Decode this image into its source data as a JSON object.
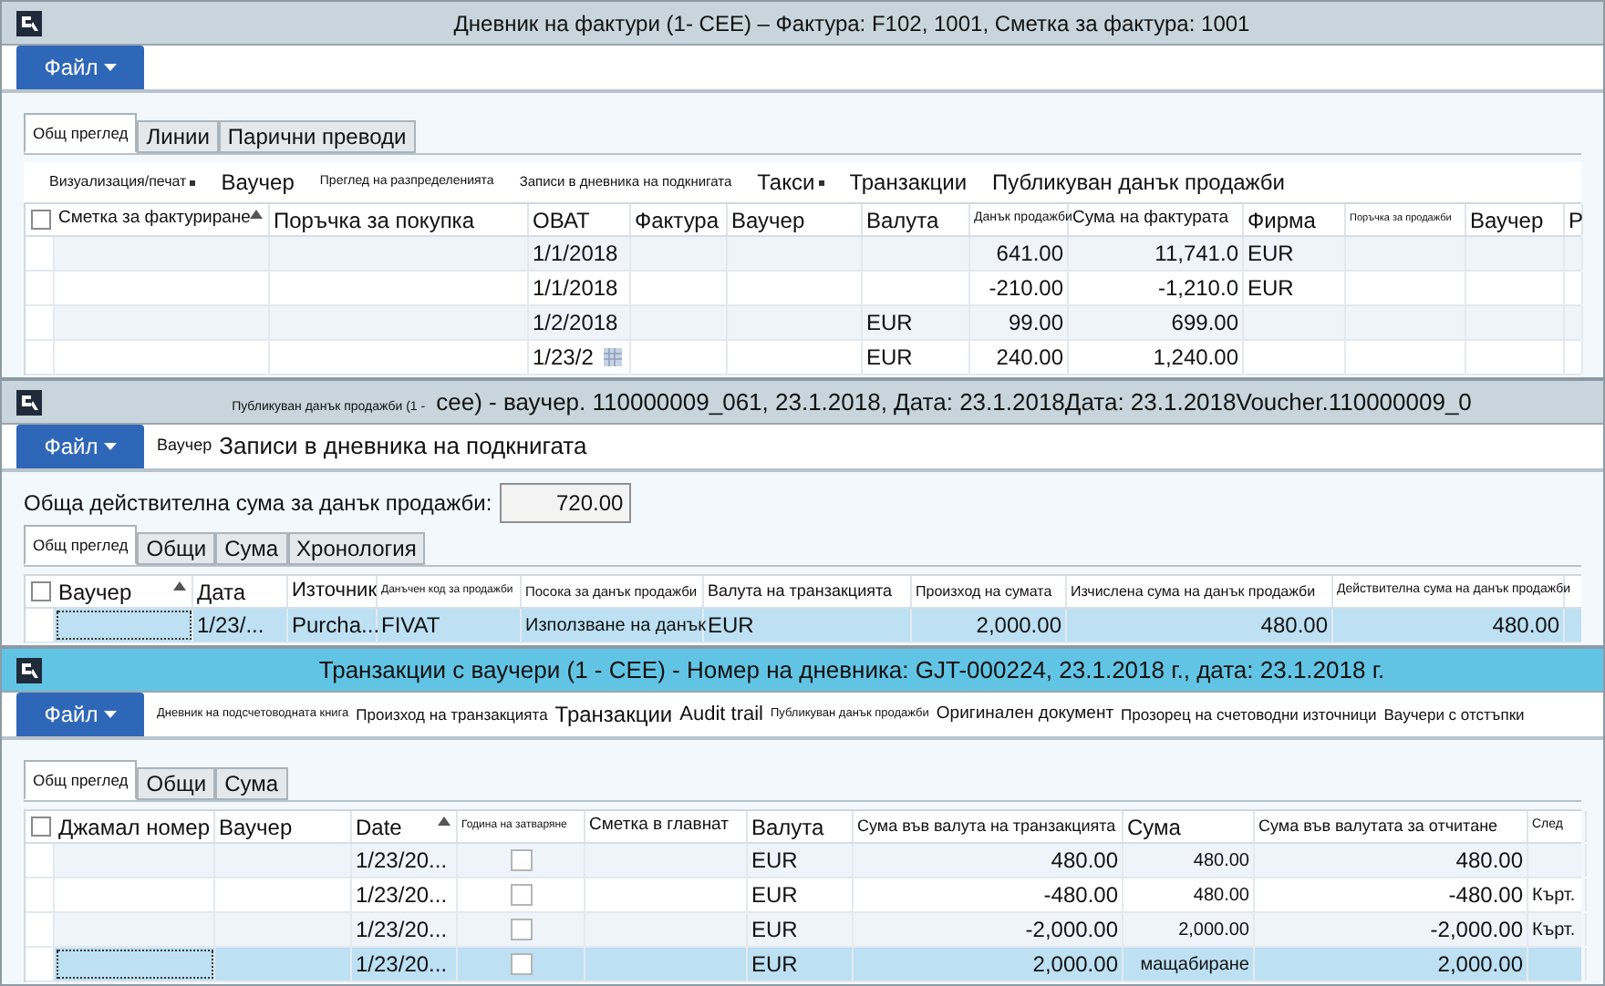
{
  "windows": [
    {
      "active": false,
      "title_parts": [
        "Дневник на фактури (1- CEE) –  Фактура: F102, 1001, Сметка за фактура: 1001"
      ],
      "file_button": "Файл",
      "tabs": [
        {
          "label": "Общ преглед",
          "selected": true
        },
        {
          "label": "Линии",
          "selected": false
        },
        {
          "label": "Парични преводи",
          "selected": false
        }
      ],
      "toolbar": [
        {
          "label": "Визуализация/печат",
          "dropdown": true
        },
        {
          "label": "Ваучер",
          "dropdown": false
        },
        {
          "label": "Преглед на разпределенията",
          "dropdown": false
        },
        {
          "label": "Записи в дневника на подкнигата",
          "dropdown": false
        },
        {
          "label": "Такси",
          "dropdown": true
        },
        {
          "label": "Транзакции",
          "dropdown": false
        },
        {
          "label": "Публикуван данък продажби",
          "dropdown": false
        }
      ],
      "grid": {
        "all_selected": false,
        "columns": [
          {
            "label": "Сметка за фактуриране",
            "kind": "text",
            "sorted": true
          },
          {
            "label": "Поръчка за покупка",
            "kind": "text",
            "sorted": false
          },
          {
            "label": "ОВАТ",
            "kind": "text",
            "sorted": false
          },
          {
            "label": "Фактура",
            "kind": "text",
            "sorted": false
          },
          {
            "label": "Ваучер",
            "kind": "text",
            "sorted": false
          },
          {
            "label": "Валута",
            "kind": "text",
            "sorted": false
          },
          {
            "label": "Данък продажби",
            "kind": "number",
            "sorted": false
          },
          {
            "label": "Сума на фактурата",
            "kind": "number",
            "sorted": false
          },
          {
            "label": "Фирма",
            "kind": "text",
            "sorted": false
          },
          {
            "label": "Поръчка за продажби",
            "kind": "text",
            "sorted": false
          },
          {
            "label": "Ваучер",
            "kind": "text",
            "sorted": false
          },
          {
            "label": "Р",
            "kind": "text",
            "sorted": false
          }
        ],
        "rows": [
          {
            "selected": false,
            "date_picker": false,
            "cells": [
              null,
              null,
              "1/1/2018",
              null,
              null,
              null,
              "641.00",
              "11,741.0",
              "EUR",
              null,
              null,
              null
            ]
          },
          {
            "selected": false,
            "date_picker": false,
            "cells": [
              null,
              null,
              "1/1/2018",
              null,
              null,
              null,
              "-210.00",
              "-1,210.0",
              "EUR",
              null,
              null,
              null
            ]
          },
          {
            "selected": false,
            "date_picker": false,
            "cells": [
              null,
              null,
              "1/2/2018",
              null,
              null,
              "EUR",
              "99.00",
              "699.00",
              null,
              null,
              null,
              null
            ]
          },
          {
            "selected": false,
            "date_picker": true,
            "cells": [
              null,
              null,
              "1/23/2",
              null,
              null,
              "EUR",
              "240.00",
              "1,240.00",
              null,
              null,
              null,
              null
            ]
          }
        ]
      }
    },
    {
      "active": false,
      "title_parts": [
        "Публикуван данък продажби (1 -",
        "cee) - ваучер. 110000009_061, 23.1.2018, Дата: 23.1.2018Дата: 23.1.2018Voucher.110000009_0"
      ],
      "file_button": "Файл",
      "menu": [
        "Ваучер",
        "Записи в дневника на подкнигата"
      ],
      "total_field": {
        "label": "Обща действителна сума за данък продажби:",
        "value": "720.00"
      },
      "tabs": [
        {
          "label": "Общ преглед",
          "selected": true
        },
        {
          "label": "Общи",
          "selected": false
        },
        {
          "label": "Сума",
          "selected": false
        },
        {
          "label": "Хронология",
          "selected": false
        }
      ],
      "grid": {
        "all_selected": false,
        "columns": [
          {
            "label": "Ваучер",
            "kind": "text",
            "sorted": true
          },
          {
            "label": "Дата",
            "kind": "text",
            "sorted": false
          },
          {
            "label": "Източник",
            "kind": "text",
            "sorted": false
          },
          {
            "label": "Данъчен код за продажби",
            "kind": "text",
            "sorted": false
          },
          {
            "label": "Посока за данък продажби",
            "kind": "text",
            "sorted": false
          },
          {
            "label": "Валута на транзакцията",
            "kind": "text",
            "sorted": false
          },
          {
            "label": "Произход на сумата",
            "kind": "number",
            "sorted": false
          },
          {
            "label": "Изчислена сума на данък продажби",
            "kind": "number",
            "sorted": false
          },
          {
            "label": "Действителна сума на данък продажби",
            "kind": "number",
            "sorted": false
          }
        ],
        "rows": [
          {
            "selected": true,
            "date_picker": false,
            "cells": [
              null,
              "1/23/...",
              "Purcha...",
              "FIVAT",
              "Използване на данък",
              "EUR",
              "2,000.00",
              "480.00",
              "480.00"
            ]
          }
        ]
      }
    },
    {
      "active": true,
      "title_parts": [
        "Транзакции с ваучери (1 - CEE) - Номер на дневника: GJT-000224, 23.1.2018 г., дата: 23.1.2018 г."
      ],
      "file_button": "Файл",
      "menu": [
        "Дневник на подсчетоводната книга",
        "Произход на транзакцията",
        "Транзакции",
        "Audit trail",
        "Публикуван данък продажби",
        "Оригинален документ",
        "Прозорец на счетоводни източници",
        "Ваучери с отстъпки"
      ],
      "tabs": [
        {
          "label": "Общ преглед",
          "selected": true
        },
        {
          "label": "Общи",
          "selected": false
        },
        {
          "label": "Сума",
          "selected": false
        }
      ],
      "grid": {
        "all_selected": false,
        "columns": [
          {
            "label": "Джамал номер",
            "kind": "text",
            "sorted": false
          },
          {
            "label": "Ваучер",
            "kind": "text",
            "sorted": false
          },
          {
            "label": "Date",
            "kind": "text",
            "sorted": true
          },
          {
            "label": "Година на затваряне",
            "kind": "checkbox",
            "sorted": false
          },
          {
            "label": "Сметка в главнат",
            "kind": "text",
            "sorted": false
          },
          {
            "label": "Валута",
            "kind": "text",
            "sorted": false
          },
          {
            "label": "Сума във валута на транзакцията",
            "kind": "number",
            "sorted": false
          },
          {
            "label": "Сума",
            "kind": "number",
            "sorted": false
          },
          {
            "label": "Сума във валутата за отчитане",
            "kind": "number",
            "sorted": false
          },
          {
            "label": "След",
            "kind": "text",
            "sorted": false
          }
        ],
        "rows": [
          {
            "selected": false,
            "date_picker": false,
            "cells": [
              null,
              null,
              "1/23/20...",
              false,
              null,
              "EUR",
              "480.00",
              "480.00",
              "480.00",
              null
            ]
          },
          {
            "selected": false,
            "date_picker": false,
            "cells": [
              null,
              null,
              "1/23/20...",
              false,
              null,
              "EUR",
              "-480.00",
              "480.00",
              "-480.00",
              "Кърт."
            ]
          },
          {
            "selected": false,
            "date_picker": false,
            "cells": [
              null,
              null,
              "1/23/20...",
              false,
              null,
              "EUR",
              "-2,000.00",
              "2,000.00",
              "-2,000.00",
              "Кърт."
            ]
          },
          {
            "selected": true,
            "date_picker": false,
            "cells": [
              null,
              null,
              "1/23/20...",
              false,
              null,
              "EUR",
              "2,000.00",
              "мащабиране",
              "2,000.00",
              null
            ]
          }
        ]
      }
    }
  ]
}
